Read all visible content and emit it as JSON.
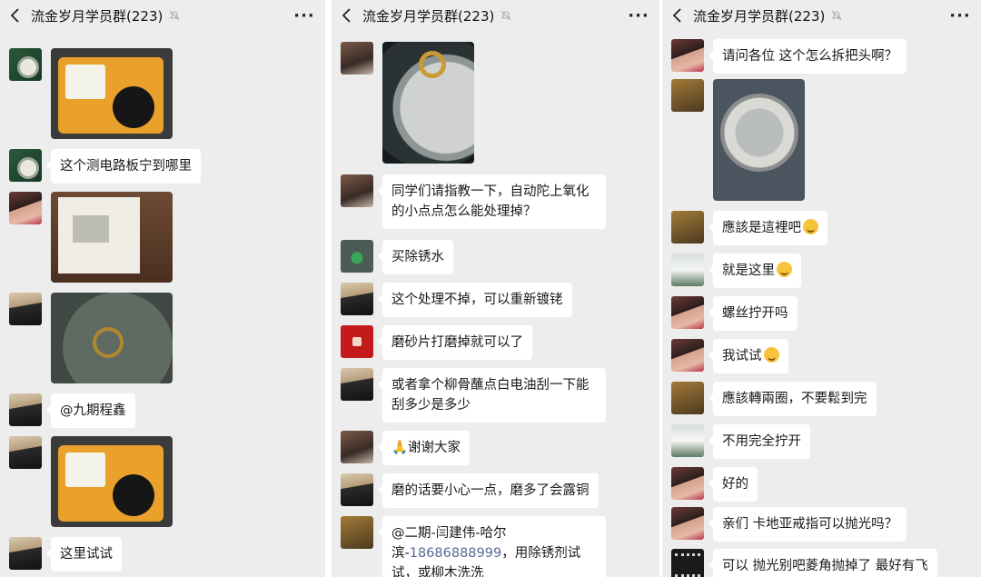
{
  "screens": [
    {
      "title": "流金岁月学员群(223)",
      "messages": [
        {
          "avatar": "watch-avatar",
          "type": "image"
        },
        {
          "avatar": "watch-avatar",
          "type": "text",
          "text": "这个测电路板宁到哪里"
        },
        {
          "avatar": "woman-avatar",
          "type": "image"
        },
        {
          "avatar": "man-avatar",
          "type": "image"
        },
        {
          "avatar": "man-avatar",
          "type": "text",
          "text": "@九期程鑫"
        },
        {
          "avatar": "man-avatar",
          "type": "image"
        },
        {
          "avatar": "man-avatar",
          "type": "text",
          "text": "这里试试"
        }
      ]
    },
    {
      "title": "流金岁月学员群(223)",
      "messages": [
        {
          "avatar": "couple-avatar",
          "type": "image"
        },
        {
          "avatar": "couple-avatar",
          "type": "text",
          "text": "同学们请指教一下，自动陀上氧化的小点点怎么能处理掉？"
        },
        {
          "avatar": "green-avatar",
          "type": "text",
          "text": "买除锈水"
        },
        {
          "avatar": "man-avatar",
          "type": "text",
          "text": "这个处理不掉，可以重新镀铑"
        },
        {
          "avatar": "red-avatar",
          "type": "text",
          "text": "磨砂片打磨掉就可以了"
        },
        {
          "avatar": "man-avatar",
          "type": "text",
          "text": "或者拿个柳骨蘸点白电油刮一下能刮多少是多少"
        },
        {
          "avatar": "couple-avatar",
          "type": "text",
          "text": "🙏谢谢大家"
        },
        {
          "avatar": "man-avatar",
          "type": "text",
          "text": "磨的话要小心一点，磨多了会露铜"
        },
        {
          "avatar": "lion-avatar",
          "type": "text",
          "text_pre": "@二期-闫建伟-哈尔滨-",
          "phone": "18686888999",
          "text_post": "，用除锈剂试试，或柳木洗洗"
        }
      ]
    },
    {
      "title": "流金岁月学员群(223)",
      "messages": [
        {
          "avatar": "woman-avatar",
          "type": "text",
          "text": "请问各位 这个怎么拆把头啊？"
        },
        {
          "avatar": "lion-avatar",
          "type": "image"
        },
        {
          "avatar": "lion-avatar",
          "type": "text",
          "text": "應該是這裡吧",
          "emoji": true
        },
        {
          "avatar": "snow-avatar",
          "type": "text",
          "text": "就是这里",
          "emoji": true
        },
        {
          "avatar": "woman-avatar",
          "type": "text",
          "text": "螺丝拧开吗"
        },
        {
          "avatar": "woman-avatar",
          "type": "text",
          "text": "我试试",
          "emoji": true
        },
        {
          "avatar": "lion-avatar",
          "type": "text",
          "text": "應該轉兩圈，不要鬆到完"
        },
        {
          "avatar": "snow-avatar",
          "type": "text",
          "text": "不用完全拧开"
        },
        {
          "avatar": "woman-avatar",
          "type": "text",
          "text": "好的"
        },
        {
          "avatar": "woman-avatar",
          "type": "text",
          "text": "亲们 卡地亚戒指可以抛光吗？"
        },
        {
          "avatar": "mart-avatar",
          "type": "text",
          "text": "可以 抛光别吧菱角抛掉了 最好有飞"
        }
      ]
    }
  ]
}
